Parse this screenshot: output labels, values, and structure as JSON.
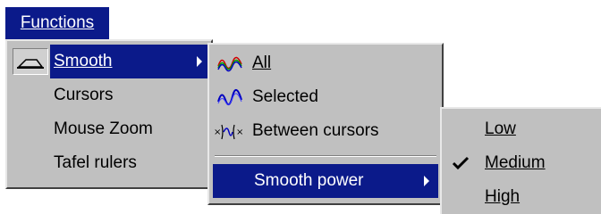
{
  "menubar": {
    "functions_label": "Functions"
  },
  "functions_menu": {
    "items": [
      {
        "label": "Smooth",
        "selected": true,
        "has_submenu": true,
        "icon": "smooth-tool-icon"
      },
      {
        "label": "Cursors"
      },
      {
        "label": "Mouse Zoom"
      },
      {
        "label": "Tafel rulers"
      }
    ]
  },
  "smooth_menu": {
    "items": [
      {
        "label": "All",
        "icon": "smooth-all-icon"
      },
      {
        "label": "Selected",
        "icon": "smooth-selected-icon"
      },
      {
        "label": "Between cursors",
        "icon": "smooth-between-cursors-icon"
      },
      {
        "label": "Smooth power",
        "selected": true,
        "has_submenu": true
      }
    ]
  },
  "power_menu": {
    "items": [
      {
        "label": "Low"
      },
      {
        "label": "Medium",
        "checked": true
      },
      {
        "label": "High"
      }
    ]
  },
  "colors": {
    "highlight": "#0b1a8a",
    "menu_bg": "#c0c0c0"
  }
}
